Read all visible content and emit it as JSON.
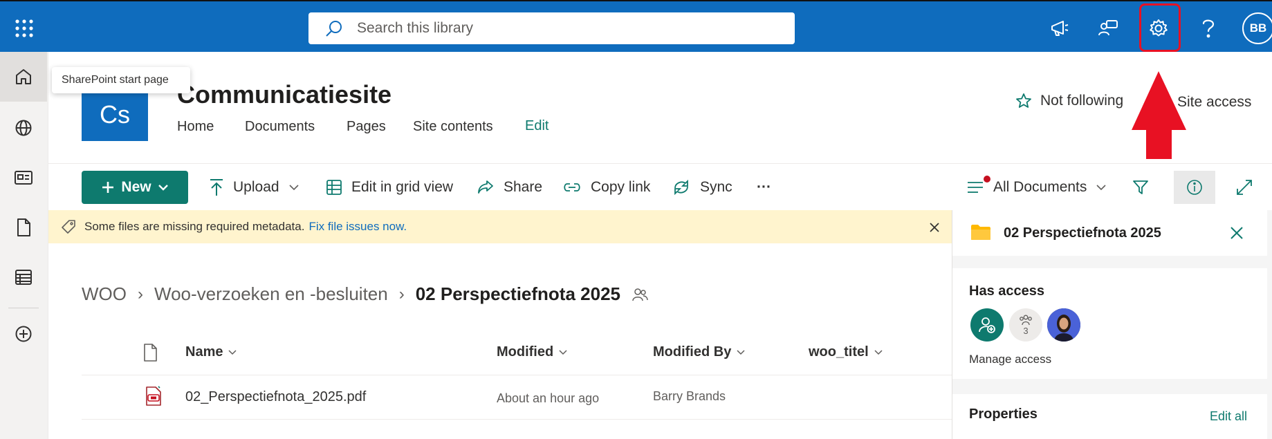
{
  "topbar": {
    "search_placeholder": "Search this library",
    "user_initials": "BB",
    "settings_highlight_color": "#e81123"
  },
  "tooltip": {
    "text": "SharePoint start page"
  },
  "site": {
    "logo_text": "Cs",
    "title": "Communicatiesite",
    "nav": [
      "Home",
      "Documents",
      "Pages",
      "Site contents",
      "Edit"
    ],
    "follow_label": "Not following",
    "site_access_label": "Site access"
  },
  "commandbar": {
    "new_label": "New",
    "upload_label": "Upload",
    "grid_label": "Edit in grid view",
    "share_label": "Share",
    "copy_link_label": "Copy link",
    "sync_label": "Sync",
    "more_label": "···",
    "view_label": "All Documents"
  },
  "banner": {
    "message": "Some files are missing required metadata.",
    "link": "Fix file issues now."
  },
  "breadcrumb": {
    "items": [
      "WOO",
      "Woo-verzoeken en -besluiten",
      "02 Perspectiefnota 2025"
    ],
    "separator": "›"
  },
  "table": {
    "columns": [
      "Name",
      "Modified",
      "Modified By",
      "woo_titel"
    ],
    "rows": [
      {
        "name": "02_Perspectiefnota_2025.pdf",
        "modified": "About an hour ago",
        "modified_by": "Barry Brands",
        "woo_titel": ""
      }
    ]
  },
  "details_pane": {
    "title": "02 Perspectiefnota 2025",
    "has_access_label": "Has access",
    "group_count": "3",
    "manage_access_label": "Manage access",
    "properties_label": "Properties",
    "edit_all_label": "Edit all"
  },
  "colors": {
    "brand": "#0f6cbd",
    "accent": "#0e7a6e",
    "banner_bg": "#fff4ce"
  }
}
